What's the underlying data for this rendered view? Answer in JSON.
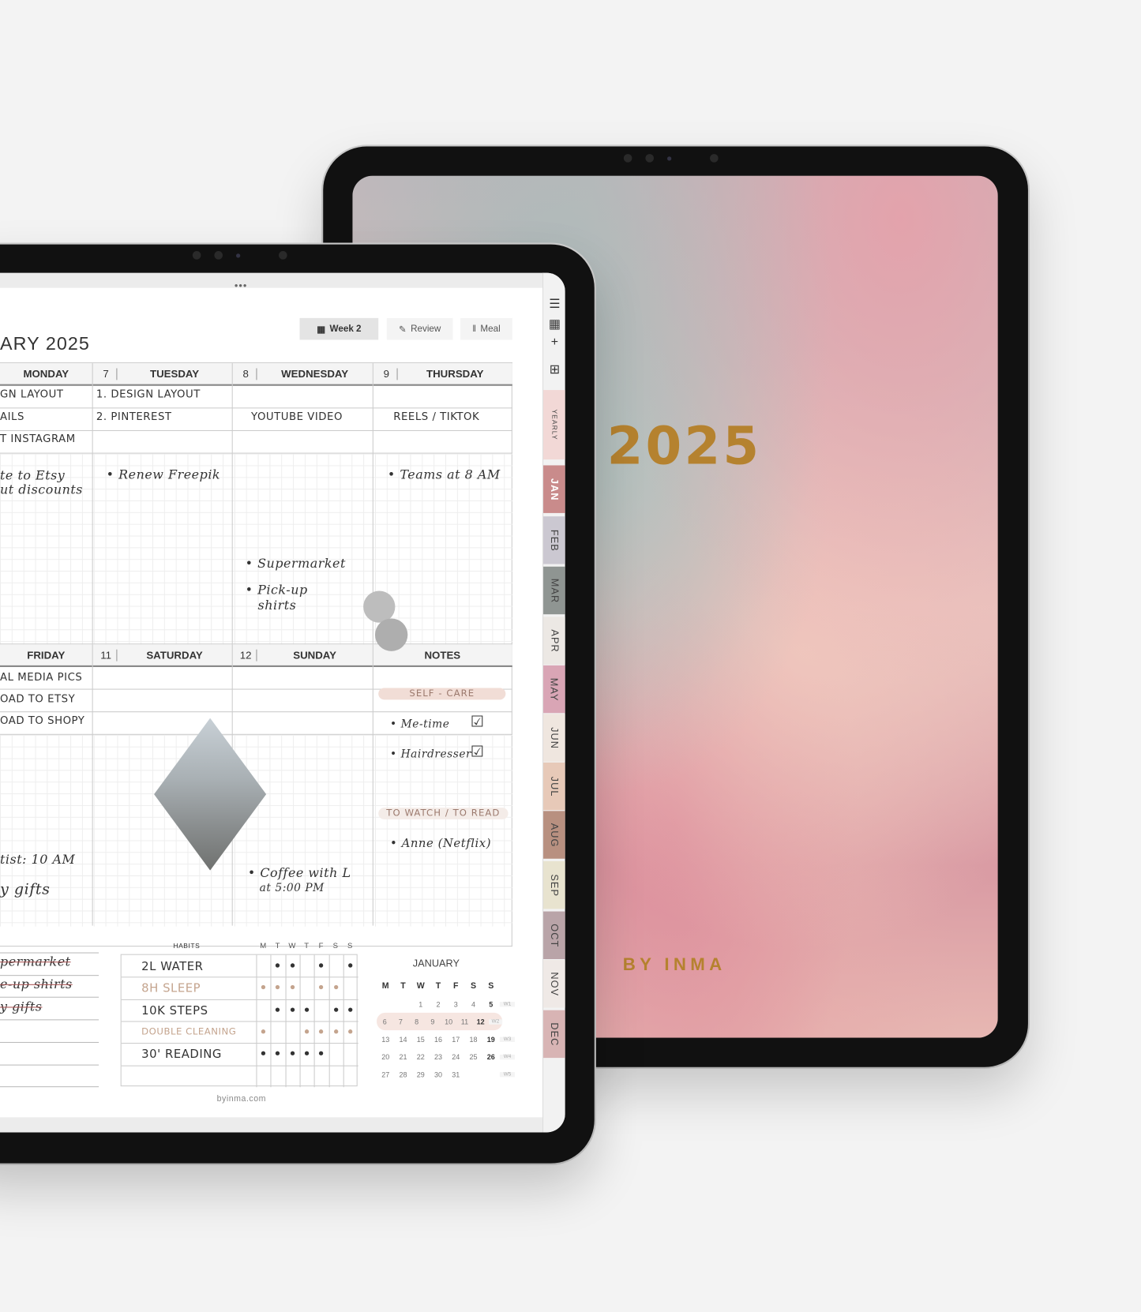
{
  "cover": {
    "year": "2025",
    "brand": "BY INMA",
    "colors": {
      "gold": "#b5822f"
    }
  },
  "planner": {
    "title": "ARY 2025",
    "buttons": [
      {
        "label": "Week 2",
        "icon": "calendar-icon",
        "active": true
      },
      {
        "label": "Review",
        "icon": "note-icon"
      },
      {
        "label": "Meal",
        "icon": "fork-icon"
      }
    ],
    "week1": [
      {
        "num": "",
        "day": "MONDAY"
      },
      {
        "num": "7",
        "day": "TUESDAY"
      },
      {
        "num": "8",
        "day": "WEDNESDAY"
      },
      {
        "num": "9",
        "day": "THURSDAY"
      }
    ],
    "week2": [
      {
        "num": "",
        "day": "FRIDAY"
      },
      {
        "num": "11",
        "day": "SATURDAY"
      },
      {
        "num": "12",
        "day": "SUNDAY"
      },
      {
        "num": "",
        "day": "NOTES"
      }
    ],
    "entries": {
      "mon": [
        "GN LAYOUT",
        "AILS",
        "T INSTAGRAM",
        "te to Etsy",
        "ut discounts"
      ],
      "tue": [
        "1. DESIGN LAYOUT",
        "2. PINTEREST",
        "• Renew Freepik"
      ],
      "wed": [
        "YOUTUBE VIDEO",
        "• Supermarket",
        "• Pick-up",
        "shirts"
      ],
      "thu": [
        "REELS / TIKTOK",
        "• Teams at 8 AM"
      ],
      "fri": [
        "AL MEDIA PICS",
        "OAD TO ETSY",
        "OAD TO SHOPY",
        "tist: 10 AM",
        "y gifts"
      ],
      "sun": [
        "• Coffee with L",
        "at 5:00 PM"
      ],
      "notes": {
        "self_care": "SELF - CARE",
        "items": [
          "• Me-time",
          "• Hairdresser"
        ],
        "to_watch": "TO WATCH / TO READ",
        "watch_items": [
          "• Anne (Netflix)"
        ]
      }
    },
    "todo": [
      "permarket",
      "e-up shirts",
      "y gifts"
    ],
    "habits": {
      "title": "HABITS",
      "days": [
        "M",
        "T",
        "W",
        "T",
        "F",
        "S",
        "S"
      ],
      "rows": [
        {
          "name": "2L WATER",
          "color": "#333",
          "done": [
            0,
            1,
            1,
            0,
            1,
            0,
            1
          ]
        },
        {
          "name": "8H SLEEP",
          "color": "#c4a48e",
          "done": [
            1,
            1,
            1,
            0,
            1,
            1,
            0
          ]
        },
        {
          "name": "10K STEPS",
          "color": "#333",
          "done": [
            0,
            1,
            1,
            1,
            0,
            1,
            1
          ]
        },
        {
          "name": "DOUBLE CLEANING",
          "color": "#c4a48e",
          "done": [
            1,
            0,
            0,
            1,
            1,
            1,
            1
          ]
        },
        {
          "name": "30' READING",
          "color": "#333",
          "done": [
            1,
            1,
            1,
            1,
            1,
            0,
            0
          ]
        },
        {
          "name": "",
          "color": "#333",
          "done": [
            0,
            0,
            0,
            0,
            0,
            0,
            0
          ]
        }
      ]
    },
    "calendar": {
      "month": "JANUARY",
      "days": [
        "M",
        "T",
        "W",
        "T",
        "F",
        "S",
        "S"
      ],
      "weeks": [
        [
          "",
          "",
          "1",
          "2",
          "3",
          "4",
          "5",
          "W1"
        ],
        [
          "6",
          "7",
          "8",
          "9",
          "10",
          "11",
          "12",
          "W2"
        ],
        [
          "13",
          "14",
          "15",
          "16",
          "17",
          "18",
          "19",
          "W3"
        ],
        [
          "20",
          "21",
          "22",
          "23",
          "24",
          "25",
          "26",
          "W4"
        ],
        [
          "27",
          "28",
          "29",
          "30",
          "31",
          "",
          "",
          "W5"
        ]
      ],
      "highlight_week": 1
    },
    "footer": "byinma.com"
  },
  "sidebar": {
    "icons": [
      "menu-icon",
      "calendar-icon",
      "plus-icon",
      "calendar-add-icon"
    ],
    "tabs": [
      {
        "label": "YEARLY",
        "color": "#f2d8d6"
      },
      {
        "label": "JAN",
        "color": "#c98b8b"
      },
      {
        "label": "FEB",
        "color": "#cbc8d1"
      },
      {
        "label": "MAR",
        "color": "#8f9592"
      },
      {
        "label": "APR",
        "color": "#ece8e4"
      },
      {
        "label": "MAY",
        "color": "#d9a5b5"
      },
      {
        "label": "JUN",
        "color": "#efe6df"
      },
      {
        "label": "JUL",
        "color": "#e7c9b8"
      },
      {
        "label": "AUG",
        "color": "#b89080"
      },
      {
        "label": "SEP",
        "color": "#e8e3cf"
      },
      {
        "label": "OCT",
        "color": "#b9a4a8"
      },
      {
        "label": "NOV",
        "color": "#efe9e6"
      },
      {
        "label": "DEC",
        "color": "#d8b4b4"
      }
    ]
  }
}
